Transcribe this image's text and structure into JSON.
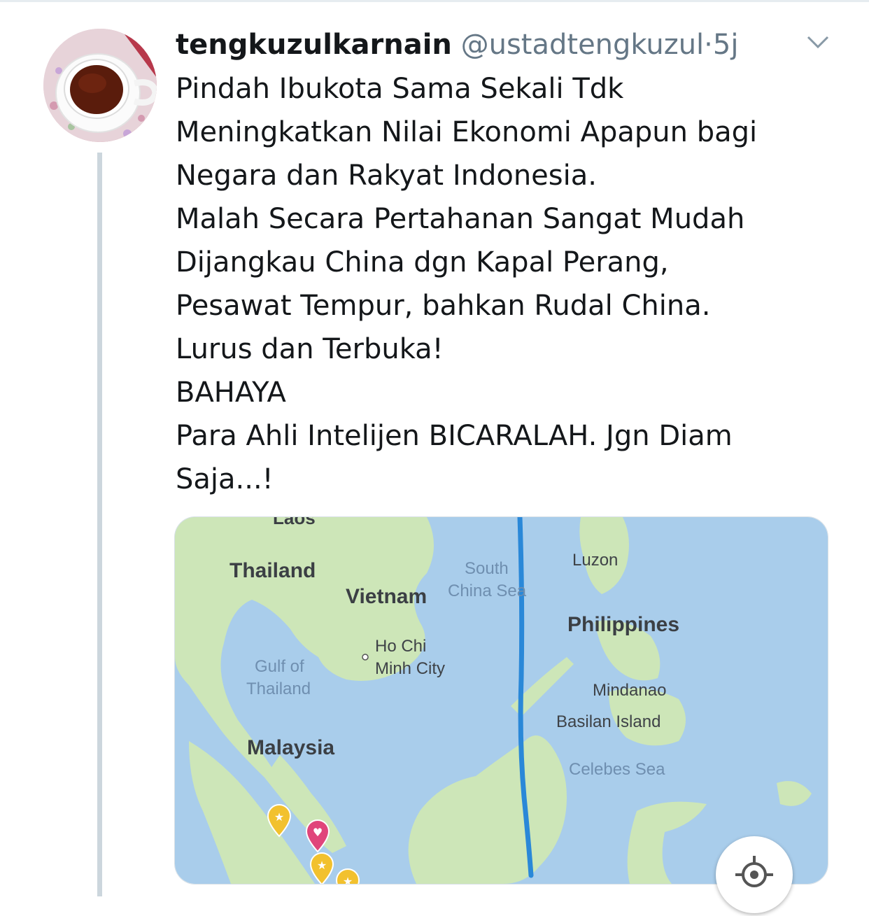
{
  "tweet": {
    "author_name": "tengkuzulkarnain",
    "handle": "@ustadtengkuzul",
    "separator": "·",
    "timestamp": "5j",
    "text_lines": [
      "Pindah Ibukota Sama Sekali Tdk",
      "Meningkatkan Nilai Ekonomi Apapun bagi",
      "Negara dan Rakyat Indonesia.",
      "Malah Secara Pertahanan Sangat Mudah",
      "Dijangkau China dgn Kapal Perang,",
      "Pesawat Tempur, bahkan Rudal China.",
      "Lurus dan Terbuka!",
      "BAHAYA",
      "Para Ahli Intelijen BICARALAH. Jgn Diam",
      "Saja...!"
    ],
    "menu_icon": "chevron-down-icon"
  },
  "map": {
    "labels": {
      "laos": "Laos",
      "thailand": "Thailand",
      "vietnam": "Vietnam",
      "south_china_sea_1": "South",
      "south_china_sea_2": "China Sea",
      "luzon": "Luzon",
      "philippines": "Philippines",
      "ho_chi_minh_1": "Ho Chi",
      "ho_chi_minh_2": "Minh City",
      "gulf_1": "Gulf of",
      "gulf_2": "Thailand",
      "mindanao": "Mindanao",
      "basilan": "Basilan Island",
      "malaysia": "Malaysia",
      "celebes_sea": "Celebes Sea"
    },
    "colors": {
      "water": "#a9cdeb",
      "land": "#cde6b8",
      "route_line": "#2a88d8",
      "pin_yellow": "#f2c12e",
      "pin_pink": "#e0457b"
    },
    "icons": [
      "star-pin-icon",
      "heart-pin-icon",
      "my-location-icon"
    ]
  },
  "colors": {
    "name_text": "#14171a",
    "meta_text": "#657786",
    "thread_line": "#ccd6dd"
  }
}
